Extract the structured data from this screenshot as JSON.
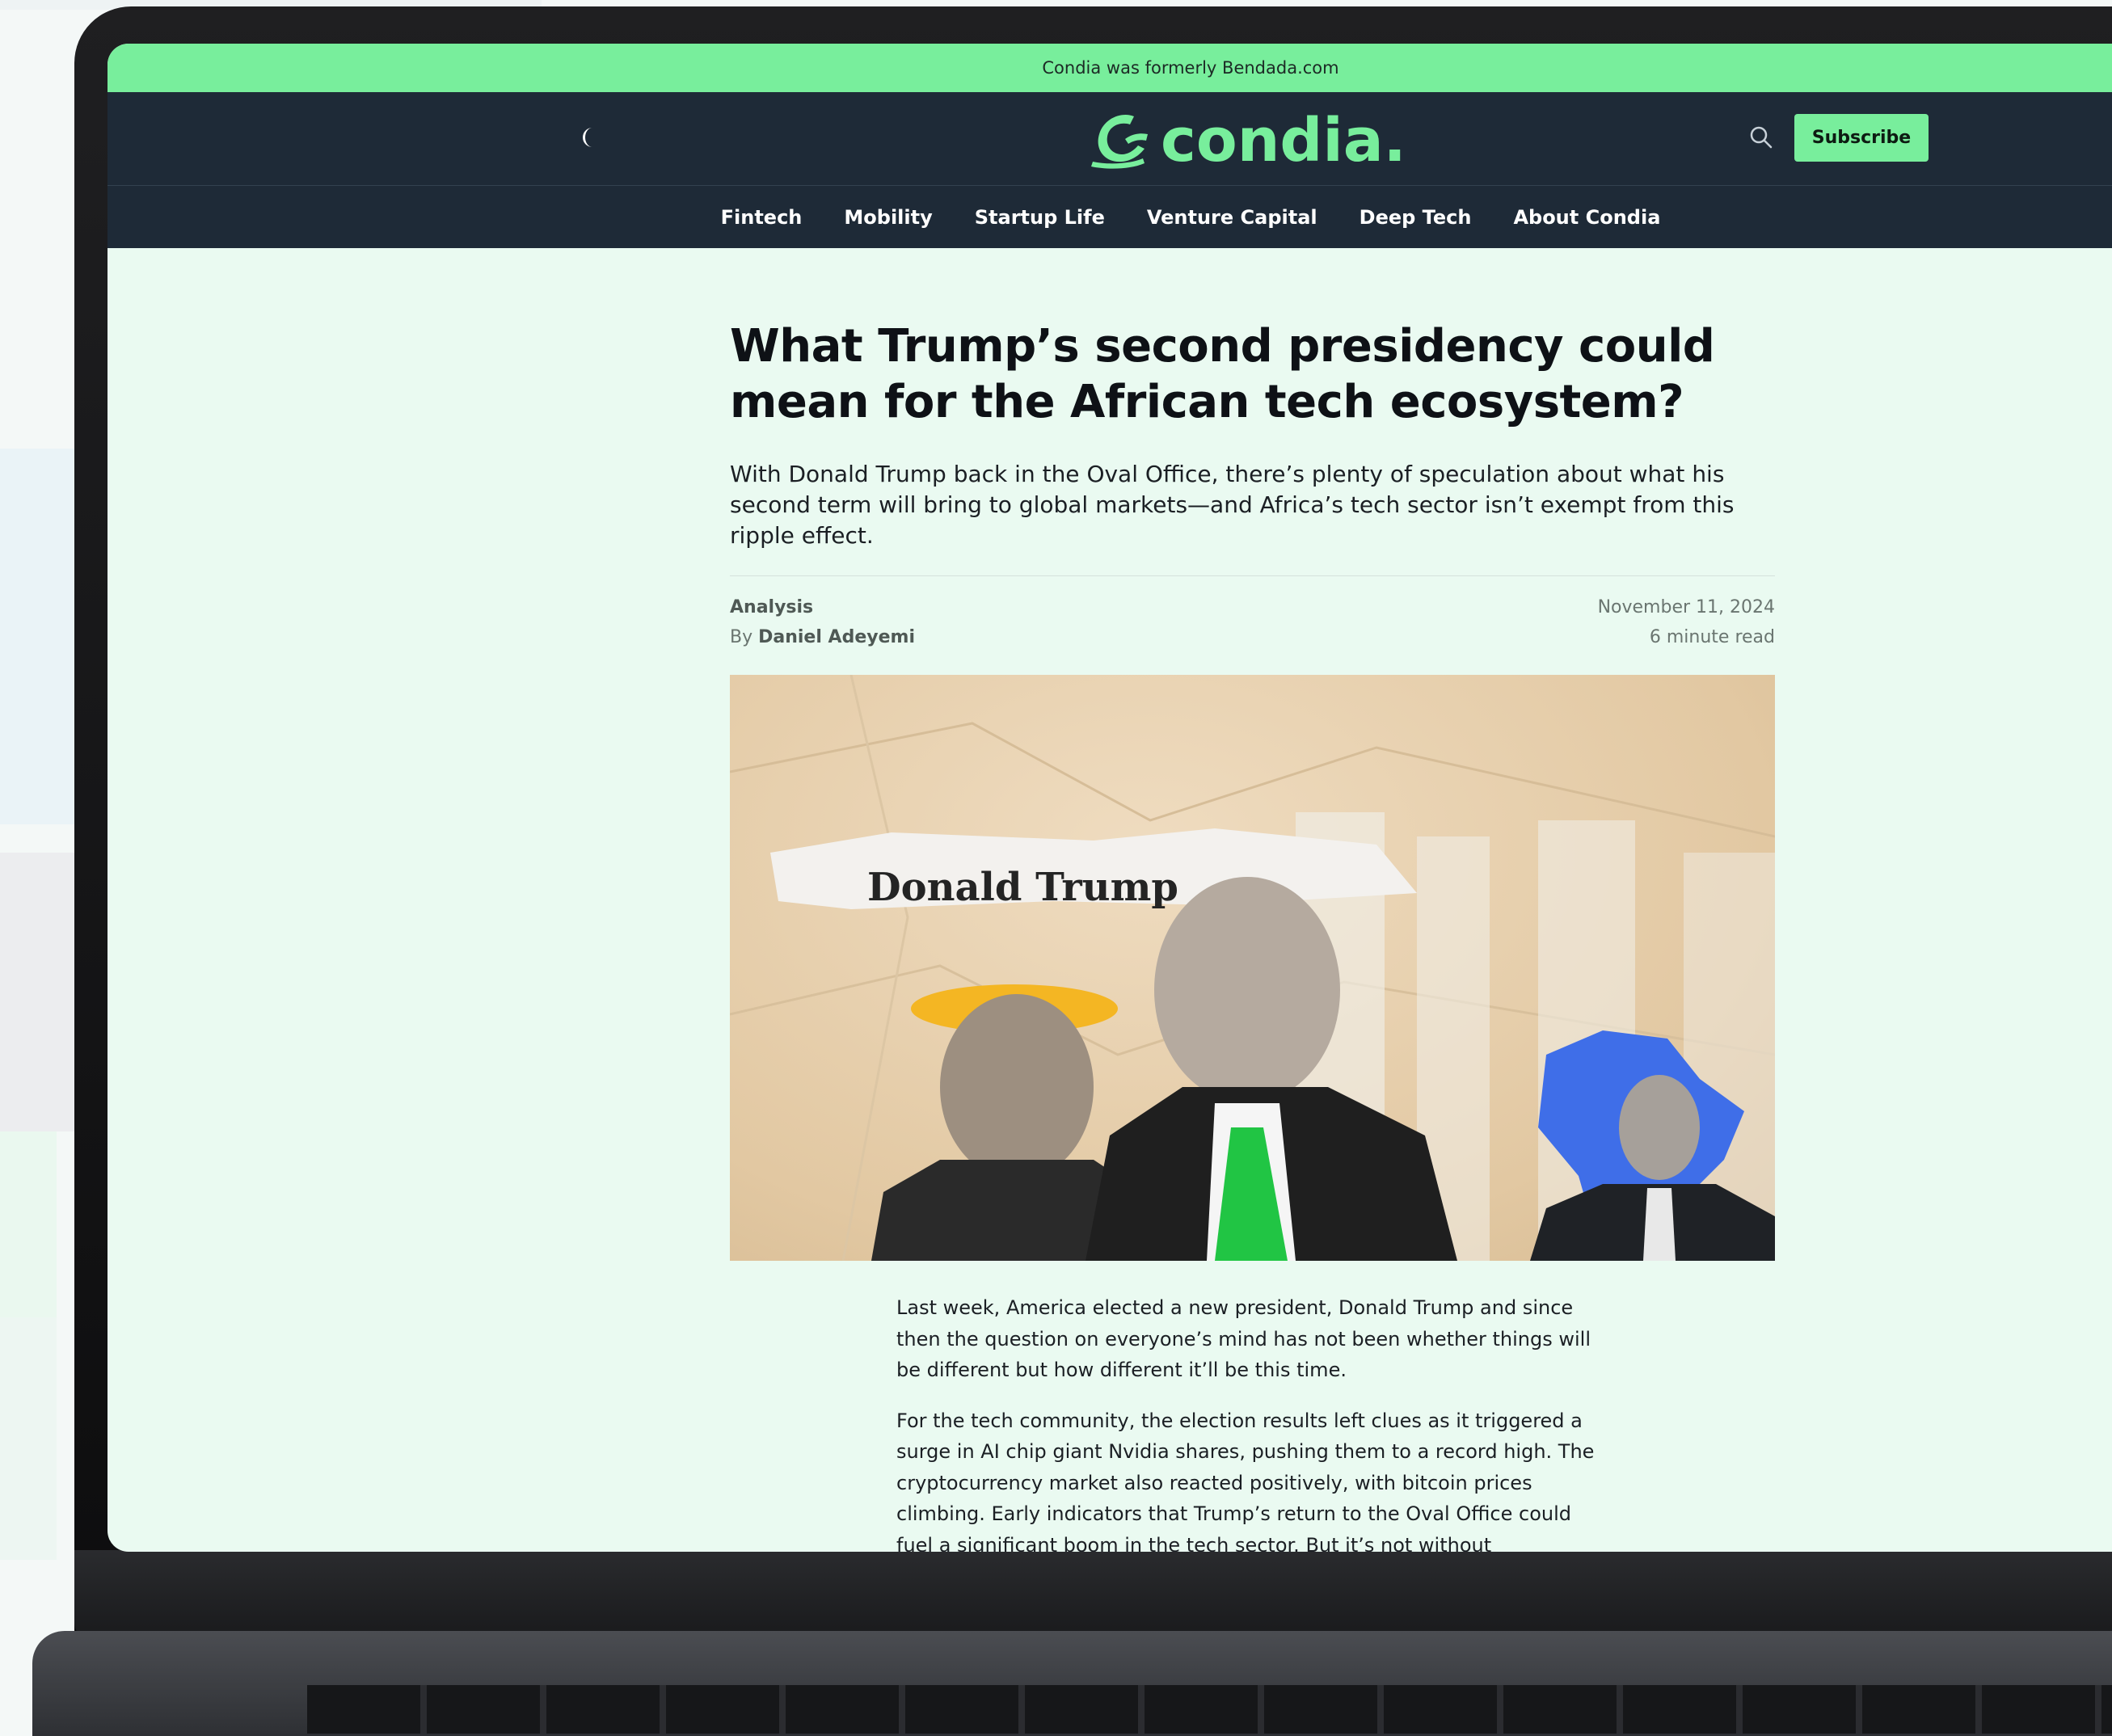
{
  "announcement": "Condia was formerly Bendada.com",
  "header": {
    "logo_text": "condia.",
    "subscribe_label": "Subscribe"
  },
  "nav": {
    "items": [
      "Fintech",
      "Mobility",
      "Startup Life",
      "Venture Capital",
      "Deep Tech",
      "About Condia"
    ]
  },
  "article": {
    "title": "What Trump’s second presidency could mean for the African tech ecosystem?",
    "dek": "With Donald Trump back in the Oval Office, there’s plenty of speculation about what his second term will bring to global markets—and Africa’s tech sector isn’t exempt from this ripple effect.",
    "category": "Analysis",
    "by_prefix": "By",
    "author": "Daniel Adeyemi",
    "date": "November 11, 2024",
    "read_time": "6 minute read",
    "image_caption_text": "Donald Trump",
    "paragraphs": [
      "Last week, America elected a new president, Donald Trump and since then the question on everyone’s mind has not been whether things will be different but how different it’ll be this time.",
      "For the tech community, the election results left clues as it triggered a surge in AI chip giant Nvidia shares, pushing them to a record high. The cryptocurrency market also reacted positively, with bitcoin prices climbing. Early indicators that Trump’s return to the Oval Office could fuel a significant boom in the tech sector. But it’s not without"
    ]
  },
  "colors": {
    "brand_green": "#78ee9c",
    "header_bg": "#1e2a37",
    "page_bg": "#eafaf1"
  }
}
